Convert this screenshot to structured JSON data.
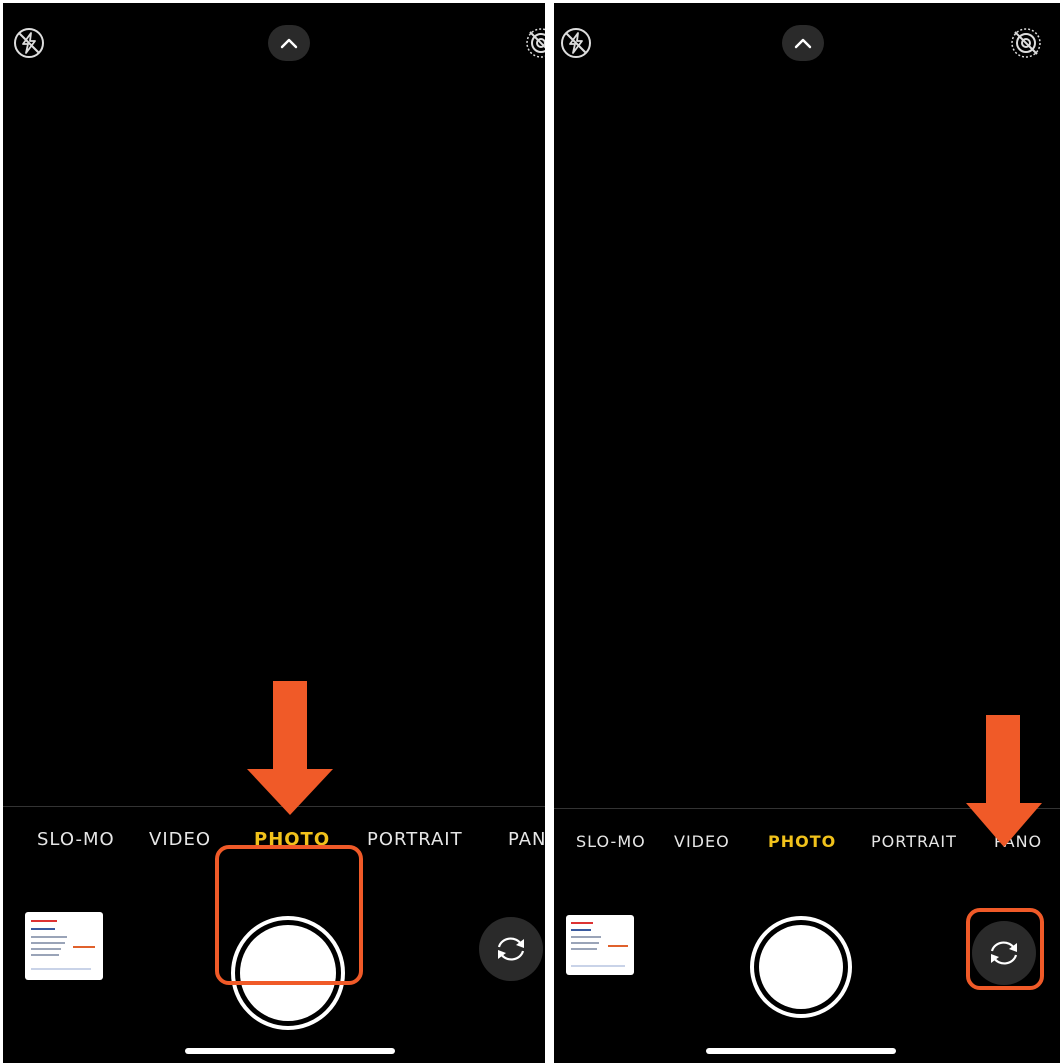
{
  "accent_color": "#f05a28",
  "active_mode_color": "#f1c21b",
  "screens": [
    {
      "id": "left",
      "top_icons": [
        "flash-off-icon",
        "chevron-up-icon",
        "live-photo-off-icon"
      ],
      "modes": [
        "SLO-MO",
        "VIDEO",
        "PHOTO",
        "PORTRAIT",
        "PANO"
      ],
      "active_mode": "PHOTO",
      "highlighted": "shutter-button"
    },
    {
      "id": "right",
      "top_icons": [
        "flash-off-icon",
        "chevron-up-icon",
        "live-photo-off-icon"
      ],
      "modes": [
        "SLO-MO",
        "VIDEO",
        "PHOTO",
        "PORTRAIT",
        "PANO"
      ],
      "active_mode": "PHOTO",
      "highlighted": "flip-camera-button"
    }
  ],
  "left": {
    "modes": {
      "slomo": "SLO-MO",
      "video": "VIDEO",
      "photo": "PHOTO",
      "portrait": "PORTRAIT",
      "pano": "PANO"
    }
  },
  "right": {
    "modes": {
      "slomo": "SLO-MO",
      "video": "VIDEO",
      "photo": "PHOTO",
      "portrait": "PORTRAIT",
      "pano": "PANO"
    }
  }
}
